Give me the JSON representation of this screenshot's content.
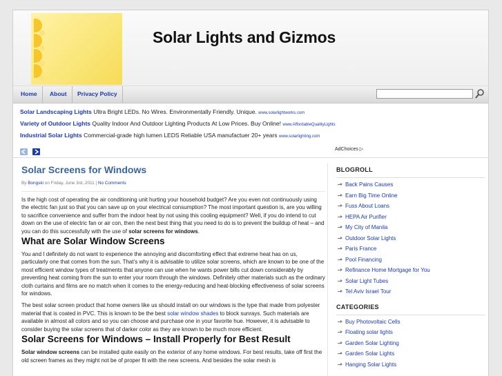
{
  "site": {
    "title": "Solar Lights and Gizmos"
  },
  "nav": {
    "items": [
      "Home",
      "About",
      "Privacy Policy"
    ],
    "search_placeholder": ""
  },
  "ads": [
    {
      "title": "Solar Landscaping Lights",
      "desc": "Ultra Bright LEDs. No Wires. Environmentally Friendly. Unique.",
      "url": "www.solarlightworks.com"
    },
    {
      "title": "Variety of Outdoor Lights",
      "desc": "Quality Indoor And Outdoor Lighting Products At Low Prices. Buy Online!",
      "url": "www.AffordableQualityLights"
    },
    {
      "title": "Industrial Solar Lights",
      "desc": "Commercial-grade high lumen LEDS Reliable USA manufactuer 20+ years",
      "url": "www.solarlighting.com"
    }
  ],
  "adchoices": "AdChoices ▷",
  "post": {
    "title": "Solar Screens for Windows",
    "meta": {
      "by": "By ",
      "author": "Bongski",
      "on": " on Friday, June 3rd, 2011 | ",
      "comments": "No Comments"
    },
    "p1": "Is the high cost of operating the air conditioning unit hurting your household budget? Are you even not continuously using the electric fan just so that you can save up on your electrical consumption? The most important question is, are you willing to sacrifice convenience and suffer from the indoor heat by not using this cooling equipment? Well, if you do intend to cut down on the use of electric fan or air con, then the next best thing that you need to do is to prevent the buildup of heat – and you can do this successfully with the use of ",
    "p1_bold": "solar screens for windows",
    "p1_end": ".",
    "h2a": "What are Solar Window Screens",
    "p2": "You and I definitely do not want to experience the annoying and discomforting effect that extreme heat has on us, particularly one that comes from the sun. That’s why it is advisable to utilize solar screens, which are known to be one of the most efficient window types of treatments that anyone can use when he wants power bills cut down considerably by preventing heat coming from the sun to enter your room through the windows. Definitely other materials such as the ordinary cloth curtains and films are no match when it comes to the energy-reducing and heat-blocking effectiveness of solar screens for windows.",
    "p3a": "The best solar screen product that home owners like us should install on our windows is the type that made from polyester material that is coated in PVC. This is known to be the best ",
    "p3_link": "solar window shades",
    "p3b": " to block sunrays. Such materials are available in almost all colors and so you can choose and purchase one in your favorite hue. However, it is advisable to consider buying the solar screens that of darker color as they are known to be much more efficient.",
    "h2b": "Solar Screens for Windows – Install Properly for Best Result",
    "p4_bold": "Solar window screens",
    "p4": " can be installed quite easily on the exterior of any home windows. For best results, take off first the old screen frames as they might not be of proper fit with the new screens. And besides the solar mesh is"
  },
  "sidebar": {
    "blogroll_title": "BLOGROLL",
    "blogroll": [
      "Back Pains Causes",
      "Earn Big Time Online",
      "Fuss About Loans",
      "HEPA Air Purifier",
      "My City of Manila",
      "Outdoor Solar Lights",
      "Paris France",
      "Pool Financing",
      "Refinance Home Mortgage for You",
      "Solar Light Tubes",
      "Tel Aviv Israel Tour"
    ],
    "categories_title": "CATEGORIES",
    "categories": [
      "Buy Photovoltaic Cells",
      "Floating solar lights",
      "Garden Solar Lighting",
      "Garden Solar Lights",
      "Hanging Solar Lights"
    ]
  },
  "colors": {
    "link": "#1d3aa6",
    "post_title": "#3a6596",
    "sun": "#f6dc58"
  }
}
